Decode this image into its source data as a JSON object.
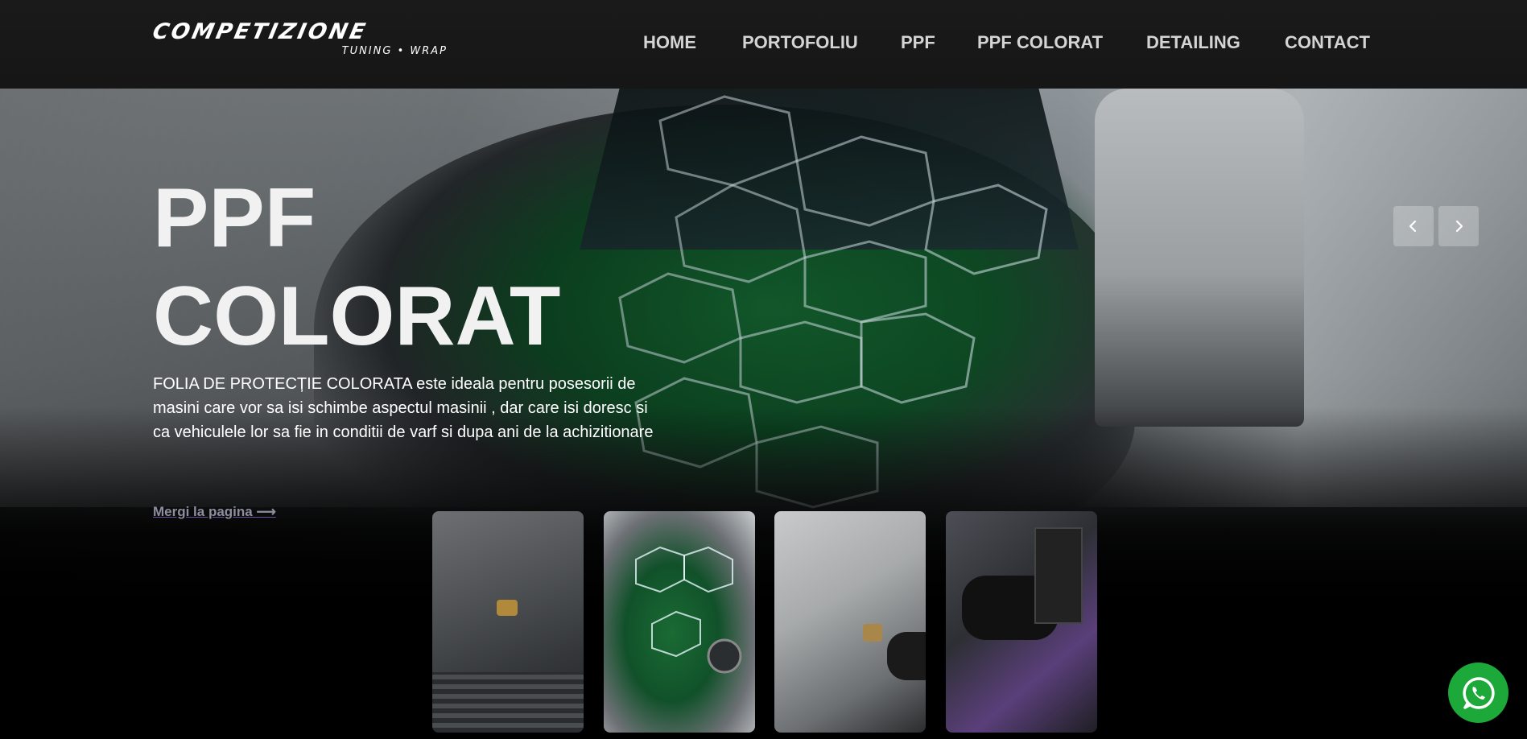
{
  "header": {
    "logo_main": "COMPETIZIONE",
    "logo_sub": "TUNING • WRAP"
  },
  "nav": {
    "items": [
      {
        "label": "HOME"
      },
      {
        "label": "PORTOFOLIU"
      },
      {
        "label": "PPF"
      },
      {
        "label": "PPF COLORAT"
      },
      {
        "label": "DETAILING"
      },
      {
        "label": "CONTACT"
      }
    ]
  },
  "hero": {
    "title_line1": "PPF",
    "title_line2": "COLORAT",
    "description": "FOLIA DE PROTECȚIE COLORATA este ideala pentru posesorii de masini care vor sa isi schimbe aspectul masinii , dar care isi doresc si ca vehiculele lor sa fie in conditii de varf si dupa ani de la achizitionare",
    "link_label": "Mergi la pagina ⟶"
  },
  "slider": {
    "prev_icon": "chevron-left-icon",
    "next_icon": "chevron-right-icon"
  },
  "thumbnails": [
    {
      "name": "thumbnail-grey-porsche-hood"
    },
    {
      "name": "thumbnail-green-porsche-ppf"
    },
    {
      "name": "thumbnail-white-porsche-polish"
    },
    {
      "name": "thumbnail-interior-detailing"
    }
  ],
  "whatsapp": {
    "icon": "whatsapp-icon"
  },
  "colors": {
    "header_bg": "#1a1a1a",
    "nav_text": "#d4d4d4",
    "accent_green": "#14602e",
    "whatsapp_green": "#1da83a",
    "link_text": "#8f8ca0"
  }
}
